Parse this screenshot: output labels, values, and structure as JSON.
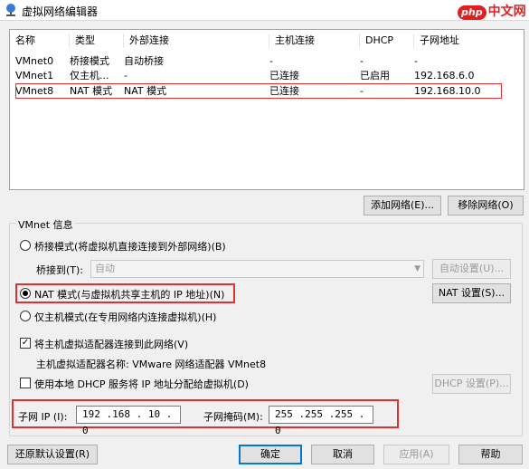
{
  "window": {
    "title": "虚拟网络编辑器",
    "watermark_badge": "php",
    "watermark_text": "中文网"
  },
  "list": {
    "columns": [
      "名称",
      "类型",
      "外部连接",
      "主机连接",
      "DHCP",
      "子网地址"
    ],
    "rows": [
      [
        "VMnet0",
        "桥接模式",
        "自动桥接",
        "-",
        "-",
        "-"
      ],
      [
        "VMnet1",
        "仅主机...",
        "-",
        "已连接",
        "已启用",
        "192.168.6.0"
      ],
      [
        "VMnet8",
        "NAT 模式",
        "NAT 模式",
        "已连接",
        "-",
        "192.168.10.0"
      ]
    ]
  },
  "buttons": {
    "add_network": "添加网络(E)...",
    "remove_network": "移除网络(O)",
    "auto_settings": "自动设置(U)...",
    "nat_settings": "NAT 设置(S)...",
    "dhcp_settings": "DHCP 设置(P)...",
    "restore_defaults": "还原默认设置(R)",
    "ok": "确定",
    "cancel": "取消",
    "apply": "应用(A)",
    "help": "帮助"
  },
  "info": {
    "group_label": "VMnet 信息",
    "bridge_radio": "桥接模式(将虚拟机直接连接到外部网络)(B)",
    "bridge_to_label": "桥接到(T):",
    "bridge_to_value": "自动",
    "nat_radio": "NAT 模式(与虚拟机共享主机的 IP 地址)(N)",
    "hostonly_radio": "仅主机模式(在专用网络内连接虚拟机)(H)",
    "connect_adapter": "将主机虚拟适配器连接到此网络(V)",
    "adapter_name": "主机虚拟适配器名称: VMware 网络适配器 VMnet8",
    "use_dhcp": "使用本地 DHCP 服务将 IP 地址分配给虚拟机(D)",
    "subnet_ip_label": "子网 IP (I):",
    "subnet_ip_value": "192 .168 . 10  .  0",
    "subnet_mask_label": "子网掩码(M):",
    "subnet_mask_value": "255 .255 .255 .  0"
  }
}
